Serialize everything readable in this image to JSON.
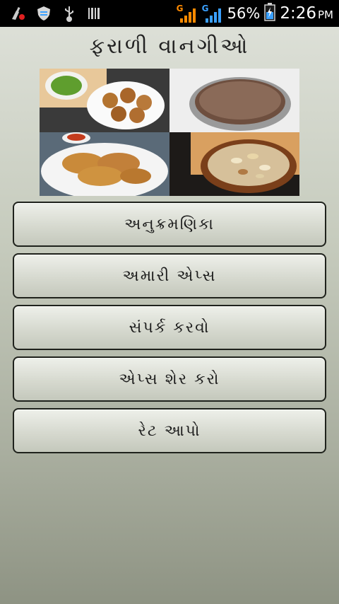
{
  "status_bar": {
    "left_icons": [
      "cleaner-icon",
      "shield-icon",
      "usb-icon",
      "barcode-icon"
    ],
    "signal1": {
      "label": "G",
      "color": "#ff8a00"
    },
    "signal2": {
      "label": "G",
      "color": "#3aa0ff"
    },
    "battery_percent": "56%",
    "time": "2:26",
    "ampm": "PM"
  },
  "app": {
    "title": "ફરાળી વાનગીઓ"
  },
  "banner": {
    "images": [
      "chutney-and-vada-plate",
      "cake-pan",
      "fried-patties-plate",
      "dry-fruit-dessert-bowl"
    ]
  },
  "menu": {
    "items": [
      {
        "label": "અનુક્રમણિકા"
      },
      {
        "label": "અમારી એપ્સ"
      },
      {
        "label": "સંપર્ક કરવો"
      },
      {
        "label": "એપ્સ શેર કરો"
      },
      {
        "label": "રેટ આપો"
      }
    ]
  }
}
